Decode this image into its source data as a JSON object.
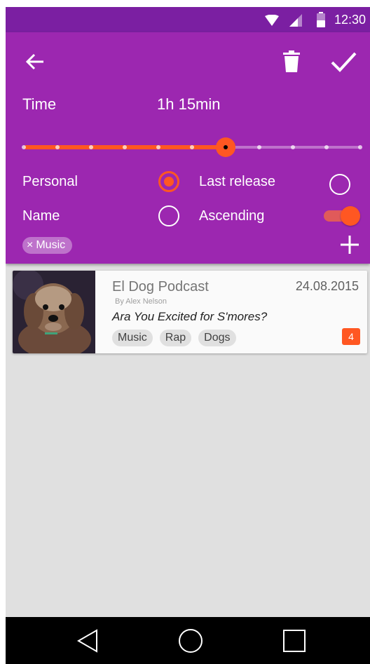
{
  "status_bar": {
    "time": "12:30",
    "icons": [
      "wifi-icon",
      "cell-signal-icon",
      "battery-icon"
    ]
  },
  "toolbar": {
    "icons": [
      "back-arrow-icon",
      "trash-icon",
      "check-icon"
    ]
  },
  "time_filter": {
    "label": "Time",
    "value": "1h 15min",
    "slider": {
      "steps": 11,
      "selected_index": 6
    }
  },
  "sort_options": {
    "personal": {
      "label": "Personal",
      "checked": true
    },
    "name": {
      "label": "Name",
      "checked": false
    },
    "last_release": {
      "label": "Last release",
      "checked": false
    },
    "ascending": {
      "label": "Ascending",
      "on": true
    }
  },
  "filter_chips": [
    {
      "label": "Music",
      "remove_symbol": "×"
    }
  ],
  "add_icon": "plus-icon",
  "card": {
    "title": "El Dog Podcast",
    "author": "By Alex Nelson",
    "episode": "Ara You Excited for S'mores?",
    "date": "24.08.2015",
    "tags": [
      "Music",
      "Rap",
      "Dogs"
    ],
    "badge": "4",
    "thumbnail": "dog-photo"
  },
  "nav_bar": {
    "icons": [
      "nav-back-icon",
      "nav-home-icon",
      "nav-recents-icon"
    ]
  },
  "colors": {
    "status_bar": "#7b1fa2",
    "app_bar": "#9c27b0",
    "accent": "#ff5722",
    "background": "#e0e0e0"
  }
}
